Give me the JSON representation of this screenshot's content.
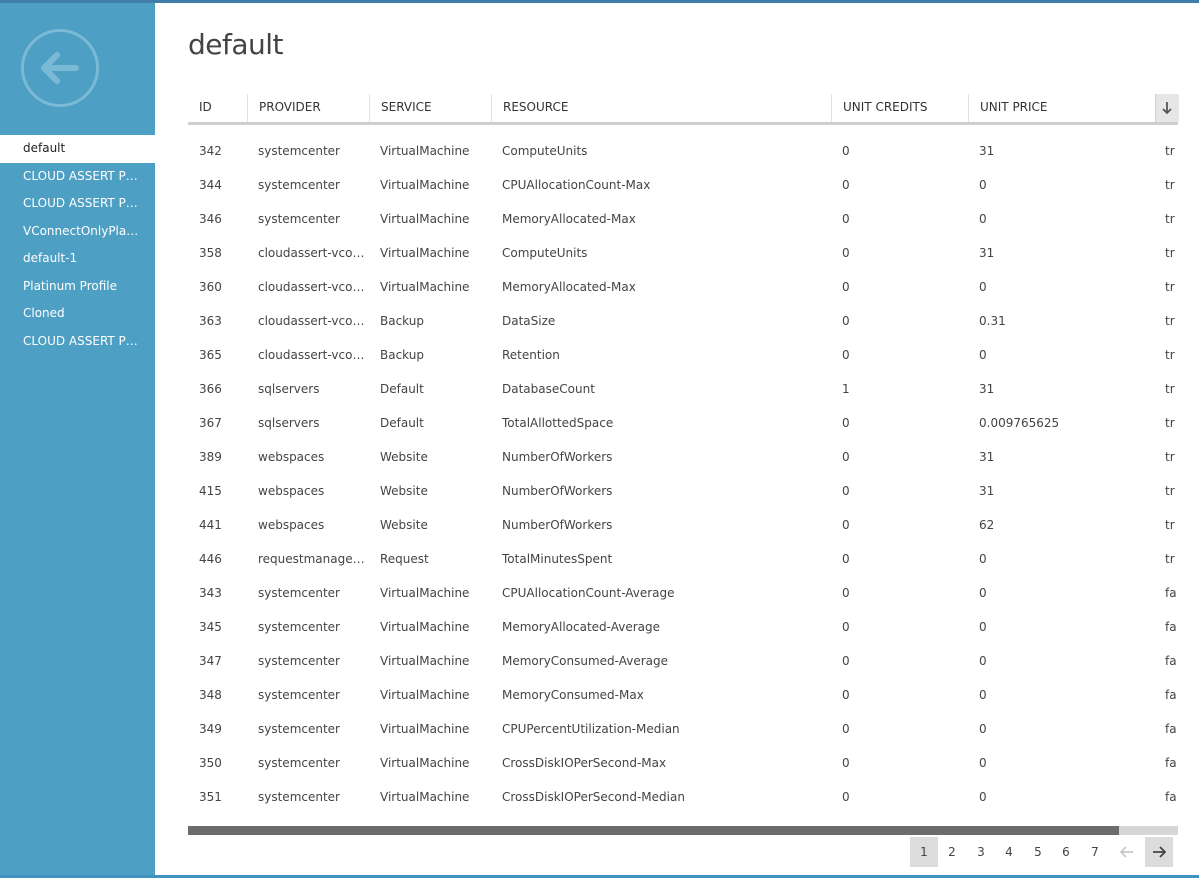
{
  "sidebar": {
    "items": [
      {
        "label": "default"
      },
      {
        "label": "CLOUD ASSERT PR..."
      },
      {
        "label": "CLOUD ASSERT PR..."
      },
      {
        "label": "VConnectOnlyPlan ..."
      },
      {
        "label": "default-1"
      },
      {
        "label": "Platinum Profile"
      },
      {
        "label": "Cloned"
      },
      {
        "label": "CLOUD ASSERT PR..."
      }
    ]
  },
  "page": {
    "title": "default"
  },
  "table": {
    "columns": [
      "ID",
      "PROVIDER",
      "SERVICE",
      "RESOURCE",
      "UNIT CREDITS",
      "UNIT PRICE"
    ],
    "rows": [
      [
        "342",
        "systemcenter",
        "VirtualMachine",
        "ComputeUnits",
        "0",
        "31",
        "tr"
      ],
      [
        "344",
        "systemcenter",
        "VirtualMachine",
        "CPUAllocationCount-Max",
        "0",
        "0",
        "tr"
      ],
      [
        "346",
        "systemcenter",
        "VirtualMachine",
        "MemoryAllocated-Max",
        "0",
        "0",
        "tr"
      ],
      [
        "358",
        "cloudassert-vconn...",
        "VirtualMachine",
        "ComputeUnits",
        "0",
        "31",
        "tr"
      ],
      [
        "360",
        "cloudassert-vconn...",
        "VirtualMachine",
        "MemoryAllocated-Max",
        "0",
        "0",
        "tr"
      ],
      [
        "363",
        "cloudassert-vconn...",
        "Backup",
        "DataSize",
        "0",
        "0.31",
        "tr"
      ],
      [
        "365",
        "cloudassert-vconn...",
        "Backup",
        "Retention",
        "0",
        "0",
        "tr"
      ],
      [
        "366",
        "sqlservers",
        "Default",
        "DatabaseCount",
        "1",
        "31",
        "tr"
      ],
      [
        "367",
        "sqlservers",
        "Default",
        "TotalAllottedSpace",
        "0",
        "0.009765625",
        "tr"
      ],
      [
        "389",
        "webspaces",
        "Website",
        "NumberOfWorkers",
        "0",
        "31",
        "tr"
      ],
      [
        "415",
        "webspaces",
        "Website",
        "NumberOfWorkers",
        "0",
        "31",
        "tr"
      ],
      [
        "441",
        "webspaces",
        "Website",
        "NumberOfWorkers",
        "0",
        "62",
        "tr"
      ],
      [
        "446",
        "requestmanagement",
        "Request",
        "TotalMinutesSpent",
        "0",
        "0",
        "tr"
      ],
      [
        "343",
        "systemcenter",
        "VirtualMachine",
        "CPUAllocationCount-Average",
        "0",
        "0",
        "fa"
      ],
      [
        "345",
        "systemcenter",
        "VirtualMachine",
        "MemoryAllocated-Average",
        "0",
        "0",
        "fa"
      ],
      [
        "347",
        "systemcenter",
        "VirtualMachine",
        "MemoryConsumed-Average",
        "0",
        "0",
        "fa"
      ],
      [
        "348",
        "systemcenter",
        "VirtualMachine",
        "MemoryConsumed-Max",
        "0",
        "0",
        "fa"
      ],
      [
        "349",
        "systemcenter",
        "VirtualMachine",
        "CPUPercentUtilization-Median",
        "0",
        "0",
        "fa"
      ],
      [
        "350",
        "systemcenter",
        "VirtualMachine",
        "CrossDiskIOPerSecond-Max",
        "0",
        "0",
        "fa"
      ],
      [
        "351",
        "systemcenter",
        "VirtualMachine",
        "CrossDiskIOPerSecond-Median",
        "0",
        "0",
        "fa"
      ]
    ]
  },
  "scrollbar": {
    "thumb_fraction": 0.94
  },
  "pagination": {
    "pages": [
      "1",
      "2",
      "3",
      "4",
      "5",
      "6",
      "7"
    ],
    "current": "1"
  },
  "icons": {
    "back": "back-arrow-icon",
    "sort": "sort-down-icon",
    "prev": "arrow-left-icon",
    "next": "arrow-right-icon"
  },
  "colors": {
    "sidebar_bg": "#4e9fc4",
    "accent": "#3f7ea8"
  }
}
